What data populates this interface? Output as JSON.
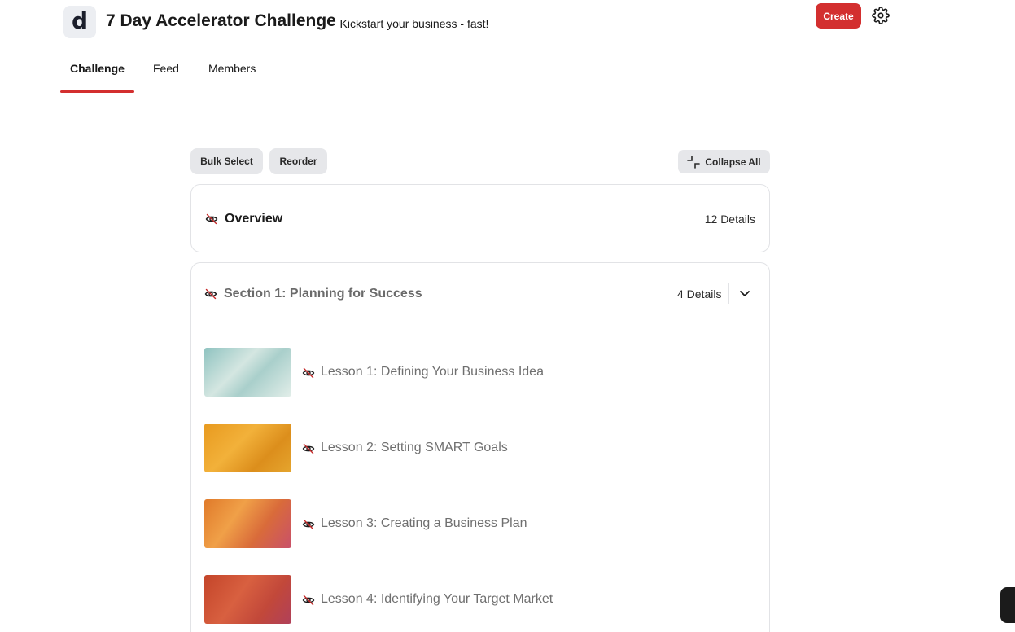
{
  "header": {
    "logo_letter": "d",
    "title": "7 Day Accelerator Challenge",
    "subtitle": "· Kickstart your business - fast!",
    "create_label": "Create"
  },
  "tabs": [
    {
      "label": "Challenge",
      "active": true
    },
    {
      "label": "Feed",
      "active": false
    },
    {
      "label": "Members",
      "active": false
    }
  ],
  "toolbar": {
    "bulk_select_label": "Bulk Select",
    "reorder_label": "Reorder",
    "collapse_all_label": "Collapse All"
  },
  "overview": {
    "title": "Overview",
    "count": "12 Details"
  },
  "section": {
    "title": "Section 1: Planning for Success",
    "count": "4 Details",
    "lessons": [
      {
        "title": "Lesson 1: Defining Your Business Idea"
      },
      {
        "title": "Lesson 2: Setting SMART Goals"
      },
      {
        "title": "Lesson 3: Creating a Business Plan"
      },
      {
        "title": "Lesson 4: Identifying Your Target Market"
      }
    ]
  },
  "colors": {
    "accent": "#d32f2f",
    "hidden_icon": "#c62828"
  }
}
